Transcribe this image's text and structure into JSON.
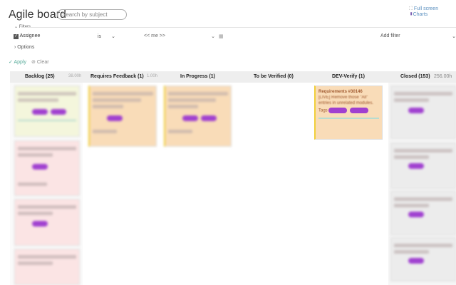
{
  "header": {
    "title": "Agile board",
    "search_placeholder": "Search by subject",
    "full_screen": "Full screen",
    "charts": "Charts"
  },
  "filters": {
    "legend": "Filters",
    "assignee_label": "Assignee",
    "operator": "is",
    "value": "<< me >>",
    "add_filter": "Add filter",
    "options": "Options",
    "apply": "Apply",
    "clear": "Clear"
  },
  "columns": [
    {
      "name": "Backlog (25)",
      "estimate": "38.00h"
    },
    {
      "name": "Requires Feedback (1)",
      "estimate": "1.00h"
    },
    {
      "name": "In Progress (1)",
      "estimate": ""
    },
    {
      "name": "To be Verified (0)",
      "estimate": ""
    },
    {
      "name": "DEV-Verify (1)",
      "estimate": ""
    },
    {
      "name": "Closed (153)",
      "estimate": "256.00h"
    }
  ],
  "dev_card": {
    "id": "Requirements #30146",
    "subject": "[LIVE] Remove those \"All\" entries in unrelated modules.",
    "tags_label": "Tags"
  }
}
